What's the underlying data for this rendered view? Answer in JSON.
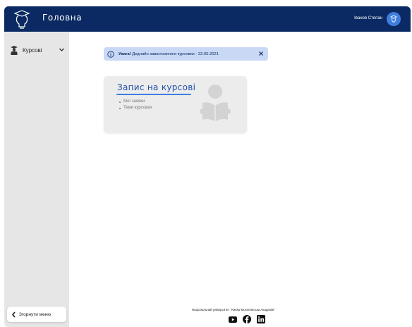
{
  "header": {
    "title": "Головна",
    "user_name": "Іванов Степан",
    "logo_icon": "graduation-bulb-icon",
    "avatar_icon": "user-avatar-icon"
  },
  "sidebar": {
    "items": [
      {
        "label": "Курсові",
        "icon": "student-icon",
        "expanded": false
      }
    ],
    "collapse_label": "Згорнути меню"
  },
  "alert": {
    "prefix": "Увага!",
    "message": " Дедлайн завантаження курсових - 22.05.2021"
  },
  "card": {
    "title": "Запис на курсові",
    "links": [
      "Мої заявки",
      "Теми курсових"
    ]
  },
  "footer": {
    "text": "Національний університет \"Києво-Могилянська Академія\"",
    "socials": [
      "youtube-icon",
      "facebook-icon",
      "linkedin-icon"
    ]
  },
  "colors": {
    "header_bg": "#0b2a63",
    "sidebar_bg": "#e6e6e6",
    "alert_bg": "#c8d8f5",
    "accent": "#3f7ee0",
    "card_title": "#1f4fa8"
  }
}
